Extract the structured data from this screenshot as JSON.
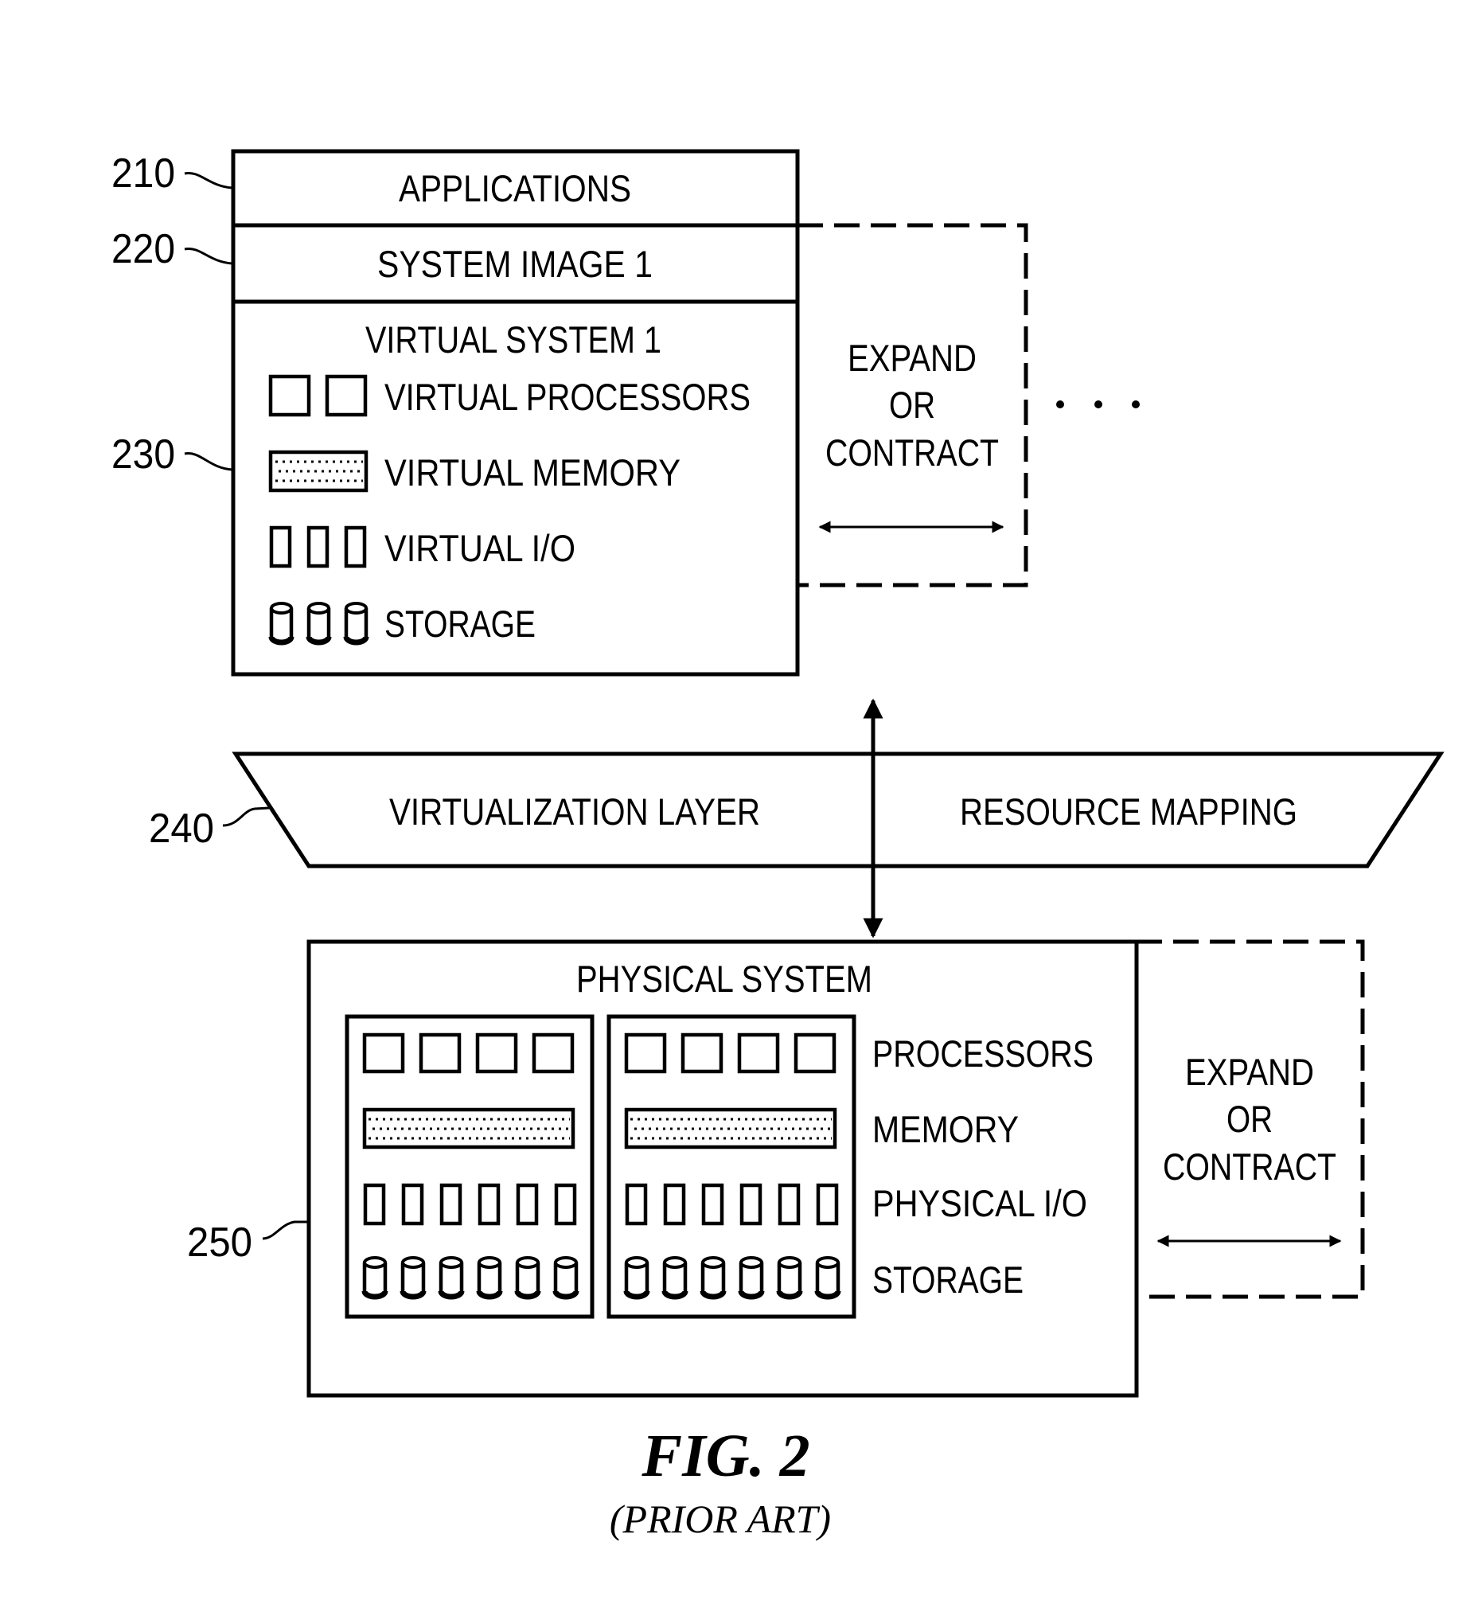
{
  "figure": {
    "caption": "FIG. 2",
    "subcaption": "(PRIOR ART)"
  },
  "reference_numerals": {
    "applications": "210",
    "system_image": "220",
    "virtual_system": "230",
    "virtualization_layer": "240",
    "physical_system": "250"
  },
  "virtual_stack": {
    "applications_label": "APPLICATIONS",
    "system_image_label": "SYSTEM IMAGE 1",
    "virtual_system_title": "VIRTUAL SYSTEM 1",
    "resources": [
      {
        "label": "VIRTUAL PROCESSORS",
        "icon": "processor-icon",
        "count": 2
      },
      {
        "label": "VIRTUAL MEMORY",
        "icon": "memory-icon",
        "count": 1
      },
      {
        "label": "VIRTUAL I/O",
        "icon": "io-icon",
        "count": 3
      },
      {
        "label": "STORAGE",
        "icon": "storage-icon",
        "count": 3
      }
    ]
  },
  "virtual_expand": {
    "lines": [
      "EXPAND",
      "OR",
      "CONTRACT"
    ],
    "ellipsis": "• • •"
  },
  "virtualization_layer": {
    "left_label": "VIRTUALIZATION LAYER",
    "right_label": "RESOURCE MAPPING"
  },
  "physical_system": {
    "title": "PHYSICAL SYSTEM",
    "units": 2,
    "resources": [
      {
        "label": "PROCESSORS",
        "icon": "processor-icon",
        "count_per_unit": 4
      },
      {
        "label": "MEMORY",
        "icon": "memory-icon",
        "count_per_unit": 1
      },
      {
        "label": "PHYSICAL I/O",
        "icon": "io-icon",
        "count_per_unit": 6
      },
      {
        "label": "STORAGE",
        "icon": "storage-icon",
        "count_per_unit": 6
      }
    ]
  },
  "physical_expand": {
    "lines": [
      "EXPAND",
      "OR",
      "CONTRACT"
    ]
  }
}
